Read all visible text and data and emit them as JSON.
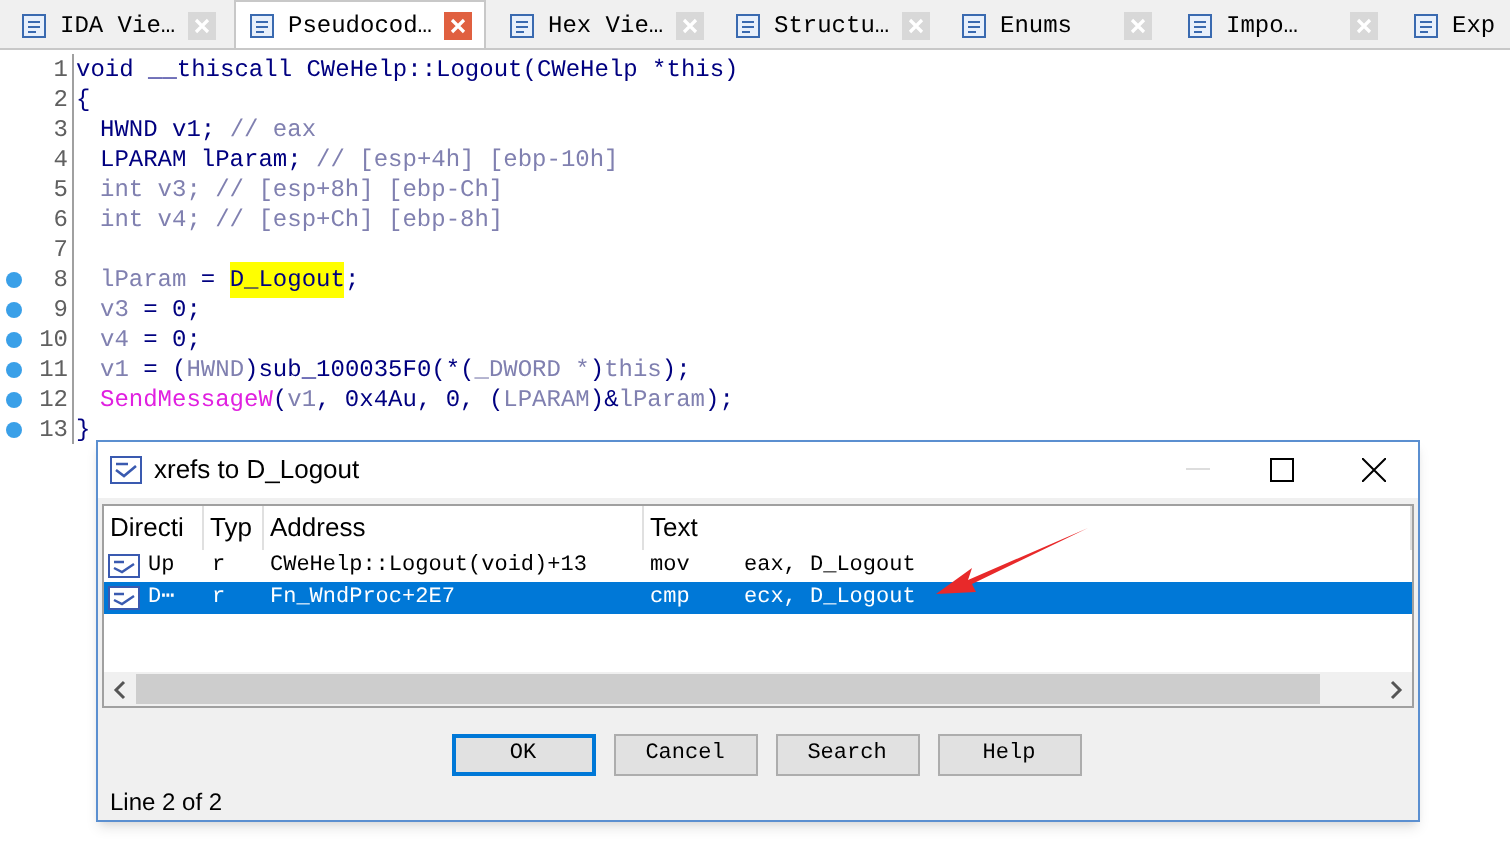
{
  "tabs": [
    {
      "label": "IDA Vie…",
      "selected": false
    },
    {
      "label": "Pseudocod…",
      "selected": true
    },
    {
      "label": "Hex Vie…",
      "selected": false
    },
    {
      "label": "Structu…",
      "selected": false
    },
    {
      "label": "Enums",
      "selected": false
    },
    {
      "label": "Impo…",
      "selected": false
    },
    {
      "label": "Exp",
      "selected": false
    }
  ],
  "code": [
    {
      "number": "1",
      "marked": false,
      "indented": false,
      "tokens": [
        {
          "kind": "code",
          "text": "void __thiscall CWeHelp::Logout(CWeHelp *this)"
        }
      ]
    },
    {
      "number": "2",
      "marked": false,
      "indented": false,
      "tokens": [
        {
          "kind": "code",
          "text": "{"
        }
      ]
    },
    {
      "number": "3",
      "marked": false,
      "indented": true,
      "tokens": [
        {
          "kind": "code",
          "text": "HWND v1; "
        },
        {
          "kind": "dim",
          "text": "// eax"
        }
      ]
    },
    {
      "number": "4",
      "marked": false,
      "indented": true,
      "tokens": [
        {
          "kind": "code",
          "text": "LPARAM lParam; "
        },
        {
          "kind": "dim",
          "text": "// [esp+4h] [ebp-10h]"
        }
      ]
    },
    {
      "number": "5",
      "marked": false,
      "indented": true,
      "tokens": [
        {
          "kind": "dim",
          "text": "int v3; // [esp+8h] [ebp-Ch]"
        }
      ]
    },
    {
      "number": "6",
      "marked": false,
      "indented": true,
      "tokens": [
        {
          "kind": "dim",
          "text": "int v4; // [esp+Ch] [ebp-8h]"
        }
      ]
    },
    {
      "number": "7",
      "marked": false,
      "indented": true
    },
    {
      "number": "8",
      "marked": true,
      "indented": true,
      "tokens": [
        {
          "kind": "dim",
          "text": "lParam"
        },
        {
          "kind": "code",
          "text": " = "
        },
        {
          "kind": "highlight",
          "text": "D_Logout"
        },
        {
          "kind": "code",
          "text": ";"
        }
      ]
    },
    {
      "number": "9",
      "marked": true,
      "indented": true,
      "tokens": [
        {
          "kind": "dim",
          "text": "v3"
        },
        {
          "kind": "code",
          "text": " = 0;"
        }
      ]
    },
    {
      "number": "10",
      "marked": true,
      "indented": true,
      "tokens": [
        {
          "kind": "dim",
          "text": "v4"
        },
        {
          "kind": "code",
          "text": " = 0;"
        }
      ]
    },
    {
      "number": "11",
      "marked": true,
      "indented": true,
      "tokens": [
        {
          "kind": "dim",
          "text": "v1"
        },
        {
          "kind": "code",
          "text": " = ("
        },
        {
          "kind": "dim",
          "text": "HWND"
        },
        {
          "kind": "code",
          "text": ")sub_100035F0(*("
        },
        {
          "kind": "dim",
          "text": "_DWORD *"
        },
        {
          "kind": "code",
          "text": ")"
        },
        {
          "kind": "dim",
          "text": "this"
        },
        {
          "kind": "code",
          "text": ");"
        }
      ]
    },
    {
      "number": "12",
      "marked": true,
      "indented": true,
      "tokens": [
        {
          "kind": "func",
          "text": "SendMessageW"
        },
        {
          "kind": "code",
          "text": "("
        },
        {
          "kind": "dim",
          "text": "v1"
        },
        {
          "kind": "code",
          "text": ", 0x4Au, 0, ("
        },
        {
          "kind": "dim",
          "text": "LPARAM"
        },
        {
          "kind": "code",
          "text": ")&"
        },
        {
          "kind": "dim",
          "text": "lParam"
        },
        {
          "kind": "code",
          "text": ");"
        }
      ]
    },
    {
      "number": "13",
      "marked": true,
      "indented": false,
      "tokens": [
        {
          "kind": "code",
          "text": "}"
        }
      ]
    }
  ],
  "dialog": {
    "title": "xrefs to D_Logout",
    "columns": [
      "Directi",
      "Typ",
      "Address",
      "Text"
    ],
    "rows": [
      {
        "selected": false,
        "direction": "Up",
        "type": "r",
        "address": "CWeHelp::Logout(void)+13",
        "mnemonic": "mov",
        "operands": "eax, D_Logout"
      },
      {
        "selected": true,
        "direction": "D⋯",
        "type": "r",
        "address": "Fn_WndProc+2E7",
        "mnemonic": "cmp",
        "operands": "ecx, D_Logout"
      }
    ],
    "buttons": [
      {
        "label": "OK",
        "default": true
      },
      {
        "label": "Cancel",
        "default": false
      },
      {
        "label": "Search",
        "default": false
      },
      {
        "label": "Help",
        "default": false
      }
    ],
    "status": "Line 2 of 2"
  }
}
